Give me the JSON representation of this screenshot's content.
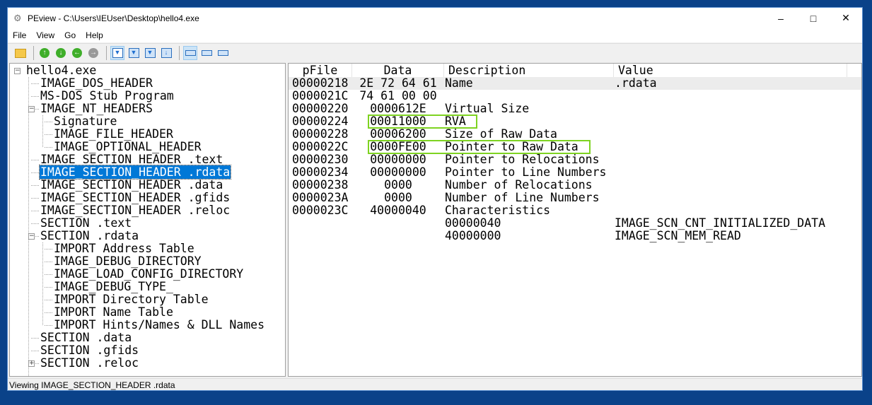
{
  "window": {
    "title": "PEview - C:\\Users\\IEUser\\Desktop\\hello4.exe",
    "controls": [
      "minimize",
      "maximize",
      "close"
    ]
  },
  "menu": [
    "File",
    "View",
    "Go",
    "Help"
  ],
  "toolbar": {
    "buttons": [
      {
        "icon": "open-folder-icon"
      },
      {
        "icon": "up-arrow-icon",
        "color": "#3fae2a"
      },
      {
        "icon": "down-arrow-icon",
        "color": "#3fae2a"
      },
      {
        "icon": "back-arrow-icon",
        "color": "#3fae2a"
      },
      {
        "icon": "forward-arrow-icon",
        "color": "#999999"
      },
      {
        "icon": "view-hex-icon",
        "active": true
      },
      {
        "icon": "view-byte-icon"
      },
      {
        "icon": "view-word-icon"
      },
      {
        "icon": "view-dword-icon"
      },
      {
        "icon": "view-wide-icon",
        "active": true
      },
      {
        "icon": "view-medium-icon"
      },
      {
        "icon": "view-narrow-icon"
      }
    ]
  },
  "tree": [
    {
      "label": "hello4.exe",
      "level": 0,
      "expander": "minus"
    },
    {
      "label": "IMAGE_DOS_HEADER",
      "level": 1
    },
    {
      "label": "MS-DOS Stub Program",
      "level": 1
    },
    {
      "label": "IMAGE_NT_HEADERS",
      "level": 1,
      "expander": "minus"
    },
    {
      "label": "Signature",
      "level": 2
    },
    {
      "label": "IMAGE_FILE_HEADER",
      "level": 2
    },
    {
      "label": "IMAGE_OPTIONAL_HEADER",
      "level": 2
    },
    {
      "label": "IMAGE_SECTION_HEADER .text",
      "level": 1
    },
    {
      "label": "IMAGE_SECTION_HEADER .rdata",
      "level": 1,
      "selected": true
    },
    {
      "label": "IMAGE_SECTION_HEADER .data",
      "level": 1
    },
    {
      "label": "IMAGE_SECTION_HEADER .gfids",
      "level": 1
    },
    {
      "label": "IMAGE_SECTION_HEADER .reloc",
      "level": 1
    },
    {
      "label": "SECTION .text",
      "level": 1
    },
    {
      "label": "SECTION .rdata",
      "level": 1,
      "expander": "minus"
    },
    {
      "label": "IMPORT Address Table",
      "level": 2
    },
    {
      "label": "IMAGE_DEBUG_DIRECTORY",
      "level": 2
    },
    {
      "label": "IMAGE_LOAD_CONFIG_DIRECTORY",
      "level": 2
    },
    {
      "label": "IMAGE_DEBUG_TYPE_",
      "level": 2
    },
    {
      "label": "IMPORT Directory Table",
      "level": 2
    },
    {
      "label": "IMPORT Name Table",
      "level": 2
    },
    {
      "label": "IMPORT Hints/Names & DLL Names",
      "level": 2
    },
    {
      "label": "SECTION .data",
      "level": 1
    },
    {
      "label": "SECTION .gfids",
      "level": 1
    },
    {
      "label": "SECTION .reloc",
      "level": 1,
      "expander": "plus"
    }
  ],
  "table": {
    "columns": [
      "pFile",
      "Data",
      "Description",
      "Value"
    ],
    "rows": [
      {
        "pfile": "00000218",
        "data": "2E 72 64 61",
        "desc": "Name",
        "value": ".rdata",
        "selected": true
      },
      {
        "pfile": "0000021C",
        "data": "74 61 00 00",
        "desc": "",
        "value": ""
      },
      {
        "pfile": "00000220",
        "data": "0000612E",
        "desc": "Virtual Size",
        "value": ""
      },
      {
        "pfile": "00000224",
        "data": "00011000",
        "desc": "RVA",
        "value": "",
        "highlight": true
      },
      {
        "pfile": "00000228",
        "data": "00006200",
        "desc": "Size of Raw Data",
        "value": ""
      },
      {
        "pfile": "0000022C",
        "data": "0000FE00",
        "desc": "Pointer to Raw Data",
        "value": "",
        "highlight": true
      },
      {
        "pfile": "00000230",
        "data": "00000000",
        "desc": "Pointer to Relocations",
        "value": ""
      },
      {
        "pfile": "00000234",
        "data": "00000000",
        "desc": "Pointer to Line Numbers",
        "value": ""
      },
      {
        "pfile": "00000238",
        "data": "0000",
        "desc": "Number of Relocations",
        "value": ""
      },
      {
        "pfile": "0000023A",
        "data": "0000",
        "desc": "Number of Line Numbers",
        "value": ""
      },
      {
        "pfile": "0000023C",
        "data": "40000040",
        "desc": "Characteristics",
        "value": ""
      },
      {
        "pfile": "",
        "data": "",
        "desc": "00000040",
        "value": "IMAGE_SCN_CNT_INITIALIZED_DATA"
      },
      {
        "pfile": "",
        "data": "",
        "desc": "40000000",
        "value": "IMAGE_SCN_MEM_READ"
      }
    ],
    "highlight_color": "#7ed321"
  },
  "status": "Viewing IMAGE_SECTION_HEADER .rdata",
  "colors": {
    "selection": "#0078d7",
    "desktop": "#0a4289"
  }
}
